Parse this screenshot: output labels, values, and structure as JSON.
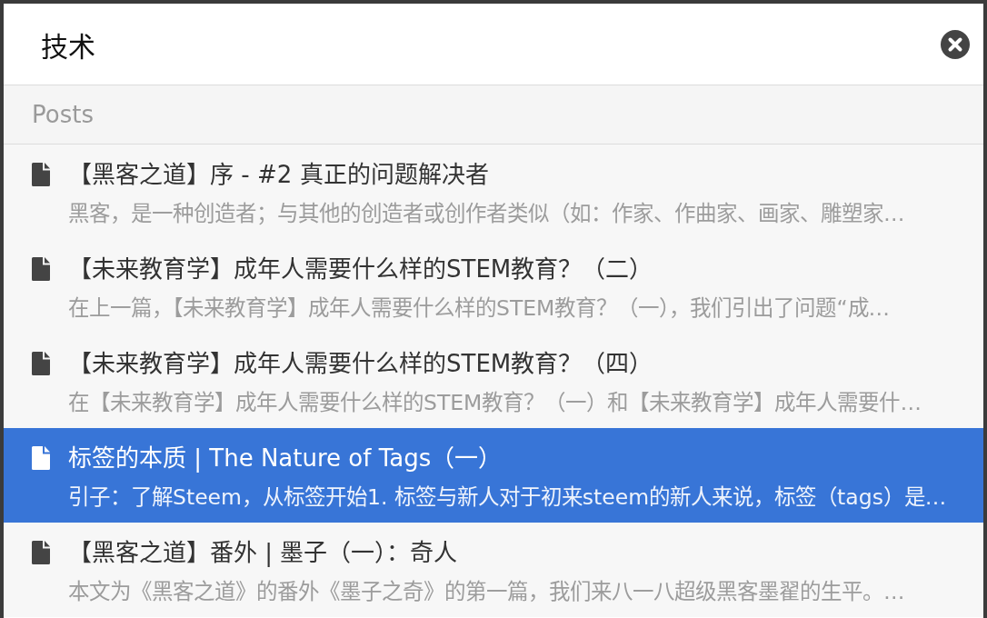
{
  "search": {
    "value": "技术"
  },
  "section": {
    "title": "Posts"
  },
  "results": [
    {
      "title": "【黑客之道】序 - #2 真正的问题解决者",
      "snippet": "黑客，是一种创造者；与其他的创造者或创作者类似（如：作家、作曲家、画家、雕塑家…",
      "selected": false
    },
    {
      "title": "【未来教育学】成年人需要什么样的STEM教育？（二）",
      "snippet": "在上一篇，【未来教育学】成年人需要什么样的STEM教育？（一），我们引出了问题“成…",
      "selected": false
    },
    {
      "title": "【未来教育学】成年人需要什么样的STEM教育？（四）",
      "snippet": "在【未来教育学】成年人需要什么样的STEM教育？（一）和【未来教育学】成年人需要什…",
      "selected": false
    },
    {
      "title": "标签的本质 | The Nature of Tags（一）",
      "snippet": "引子：了解Steem，从标签开始1. 标签与新人对于初来steem的新人来说，标签（tags）是…",
      "selected": true
    },
    {
      "title": "【黑客之道】番外 | 墨子（一）：奇人",
      "snippet": "本文为《黑客之道》的番外《墨子之奇》的第一篇，我们来八一八超级黑客墨翟的生平。…",
      "selected": false
    }
  ]
}
